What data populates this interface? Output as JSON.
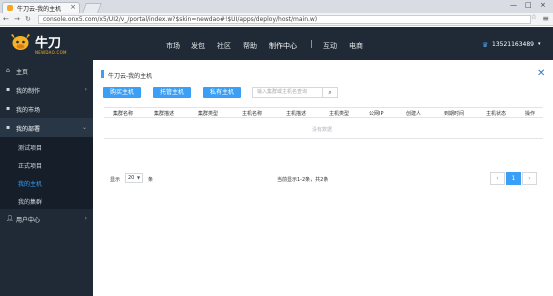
{
  "browser": {
    "tab_title": "牛刀云-我的主机",
    "tab_close": "×",
    "url": "console.onx5.com/x5/UI2/v_/portal/index.w?$skin=newdao#!$UI/apps/deploy/host/main.w)",
    "win_controls": [
      "—",
      "□",
      "×"
    ]
  },
  "header": {
    "logo_text": "牛刀",
    "logo_sub": "NEWDAO.COM",
    "nav": [
      "市场",
      "发包",
      "社区",
      "帮助",
      "制作中心",
      "互动",
      "电商"
    ],
    "user_phone": "13521163489",
    "user_caret": "▾"
  },
  "sidebar": {
    "items": [
      {
        "label": "主页",
        "icon": "home-icon"
      },
      {
        "label": "我的制作",
        "icon": "build-icon"
      },
      {
        "label": "我的市场",
        "icon": "market-icon"
      },
      {
        "label": "我的部署",
        "icon": "deploy-icon"
      },
      {
        "label": "用户中心",
        "icon": "user-icon"
      }
    ],
    "sub_items": [
      "测试项目",
      "正式项目",
      "我的主机",
      "我的集群"
    ]
  },
  "main": {
    "breadcrumb": "牛刀云-我的主机",
    "buttons": [
      "购买主机",
      "托管主机",
      "私有主机"
    ],
    "search_placeholder": "输入集群或主机名查询",
    "columns": [
      "集群名称",
      "集群描述",
      "集群类型",
      "主机名称",
      "主机描述",
      "主机类型",
      "公网IP",
      "创建人",
      "到期时间",
      "主机状态",
      "操作"
    ],
    "empty_text": "没有数据",
    "show_label": "显示",
    "page_size": "20",
    "unit_label": "条",
    "info": "当前显示1-2条，共2条",
    "pages": [
      "‹",
      "1",
      "›"
    ],
    "current_page": "1"
  },
  "colors": {
    "accent": "#3a9ff5",
    "header_bg": "#1f2a36",
    "sidebar_bg": "#1f2a36"
  }
}
